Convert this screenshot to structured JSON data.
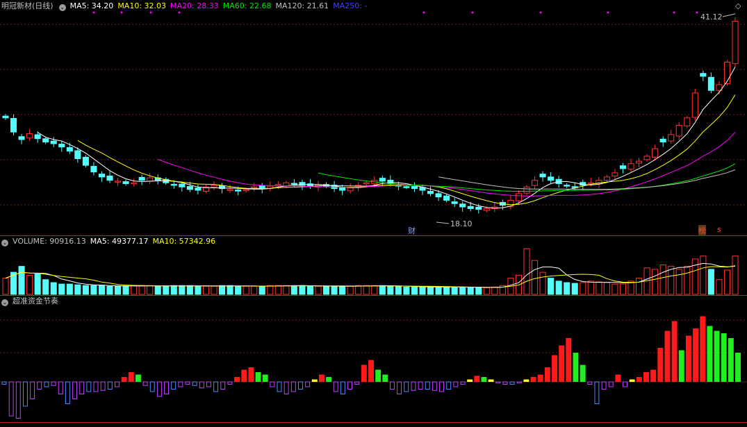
{
  "main_legend": {
    "title": "明冠新材(日线)",
    "ma5": "MA5: 34.20",
    "ma10": "MA10: 32.03",
    "ma20": "MA20: 28.33",
    "ma60": "MA60: 22.68",
    "ma120": "MA120: 21.61",
    "ma250": "MA250: -"
  },
  "volume_legend": {
    "title": "VOLUME: 90916.13",
    "ma5": "MA5: 49377.17",
    "ma10": "MA10: 57342.96"
  },
  "fund_legend": {
    "title": "超准资金节奏"
  },
  "annotations": {
    "high_price": "41.12",
    "low_price": "18.10",
    "cai_tag": "财",
    "bang_tag": "榜",
    "s_tag": "s"
  },
  "colors": {
    "up": "#ff3232",
    "down": "#54fcfc",
    "ma5": "#ffffff",
    "ma10": "#ffff00",
    "ma20": "#ff00ff",
    "ma60": "#00e600",
    "ma120": "#c0c0c0",
    "ma250": "#4040ff",
    "grid": "#7a1a1a"
  },
  "chart_data": {
    "type": "candlestick",
    "price_range": [
      18.1,
      41.12
    ],
    "close": [
      29.5,
      27.8,
      26.9,
      27.6,
      27.0,
      26.6,
      26.4,
      26.0,
      25.5,
      24.6,
      23.8,
      23.0,
      22.4,
      22.0,
      21.9,
      21.6,
      21.7,
      22.0,
      22.3,
      22.0,
      21.7,
      21.4,
      21.2,
      20.9,
      20.8,
      21.2,
      21.4,
      21.0,
      20.9,
      20.7,
      20.9,
      21.2,
      21.0,
      21.3,
      21.5,
      21.7,
      21.6,
      21.4,
      21.3,
      21.5,
      21.3,
      21.0,
      20.8,
      21.1,
      21.4,
      21.7,
      22.0,
      21.9,
      21.6,
      21.3,
      21.2,
      21.0,
      20.8,
      20.4,
      20.0,
      19.6,
      19.2,
      18.8,
      18.6,
      18.5,
      18.6,
      18.8,
      19.0,
      19.6,
      20.4,
      21.2,
      22.0,
      22.4,
      22.0,
      21.6,
      21.3,
      21.2,
      21.4,
      21.7,
      22.0,
      22.4,
      22.9,
      23.4,
      24.0,
      24.3,
      24.9,
      25.8,
      26.6,
      27.5,
      28.6,
      29.5,
      32.5,
      34.5,
      32.8,
      33.5,
      36.2,
      41.12
    ]
  },
  "volume_data": {
    "values": [
      22,
      30,
      38,
      26,
      28,
      20,
      16,
      14,
      14,
      13,
      12,
      12,
      12,
      11,
      11,
      11,
      12,
      12,
      12,
      11,
      11,
      12,
      12,
      12,
      11,
      11,
      11,
      12,
      12,
      11,
      11,
      11,
      11,
      12,
      12,
      12,
      12,
      12,
      11,
      11,
      11,
      11,
      11,
      11,
      12,
      12,
      12,
      12,
      11,
      11,
      10,
      10,
      10,
      10,
      10,
      10,
      10,
      10,
      9,
      9,
      9,
      10,
      12,
      22,
      26,
      62,
      46,
      30,
      22,
      18,
      16,
      15,
      16,
      18,
      17,
      16,
      14,
      14,
      18,
      22,
      36,
      34,
      40,
      38,
      34,
      38,
      48,
      52,
      34,
      20,
      33,
      52
    ]
  },
  "fund_data": {
    "values": [
      -2,
      -28,
      -30,
      -20,
      -14,
      -6,
      -4,
      -3,
      -10,
      -18,
      -14,
      -10,
      -8,
      -8,
      -7,
      -6,
      -4,
      4,
      8,
      6,
      -3,
      -8,
      -12,
      -10,
      -6,
      -4,
      -2,
      -3,
      -5,
      -4,
      -8,
      -6,
      -2,
      4,
      10,
      12,
      8,
      6,
      -4,
      -8,
      -10,
      -8,
      -6,
      -4,
      2,
      6,
      4,
      -8,
      -10,
      -6,
      -2,
      14,
      18,
      10,
      6,
      -6,
      -10,
      -8,
      -7,
      -6,
      -6,
      -7,
      -8,
      -6,
      -4,
      -2,
      2,
      5,
      4,
      2,
      -1,
      -2,
      -2,
      -1,
      2,
      4,
      6,
      12,
      22,
      30,
      36,
      24,
      14,
      -2,
      -18,
      -6,
      -4,
      6,
      -4,
      2,
      4,
      8,
      10,
      28,
      42,
      50,
      26,
      38,
      44,
      54,
      46,
      42,
      40,
      36,
      24
    ]
  }
}
